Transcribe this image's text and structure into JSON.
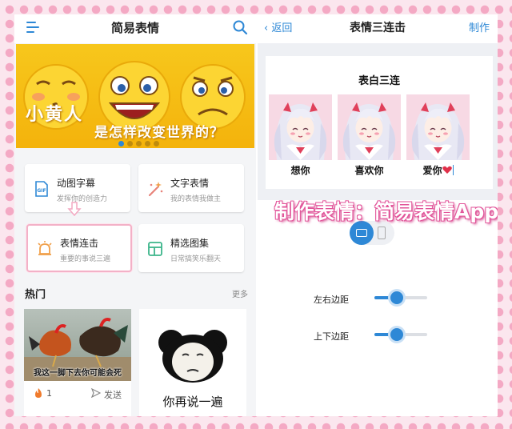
{
  "left": {
    "header": {
      "title": "简易表情"
    },
    "banner": {
      "headline": "小黄人",
      "subline": "是怎样改变世界的？",
      "page_count": 5,
      "current_page": 1
    },
    "features": [
      {
        "title": "动图字幕",
        "subtitle": "发挥你的创造力",
        "icon": "gif-icon"
      },
      {
        "title": "文字表情",
        "subtitle": "我的表情我做主",
        "icon": "magic-wand-icon"
      },
      {
        "title": "表情连击",
        "subtitle": "重要的事说三遍",
        "icon": "alarm-bell-icon"
      },
      {
        "title": "精选图集",
        "subtitle": "日常搞笑乐翻天",
        "icon": "gallery-icon"
      }
    ],
    "hot": {
      "title": "热门",
      "more": "更多",
      "posts": [
        {
          "caption": "我这一脚下去你可能会死",
          "likes": "1",
          "send_label": "发送"
        },
        {
          "caption": "你再说一遍"
        }
      ]
    }
  },
  "right": {
    "header": {
      "back_label": "返回",
      "title": "表情三连击",
      "action_label": "制作"
    },
    "preview": {
      "title": "表白三连",
      "frames": [
        {
          "caption": "想你"
        },
        {
          "caption": "喜欢你"
        },
        {
          "caption": "爱你"
        }
      ]
    },
    "options": {
      "orientation": "landscape",
      "horizontal_margin_label": "左右边距",
      "vertical_margin_label": "上下边距",
      "horizontal_margin_value": 0.4,
      "vertical_margin_value": 0.4
    }
  },
  "overlay": {
    "text": "制作表情：简易表情App"
  },
  "colors": {
    "accent": "#2e88d6",
    "pink": "#f4a9c4",
    "banner_yellow": "#f6bd14"
  }
}
